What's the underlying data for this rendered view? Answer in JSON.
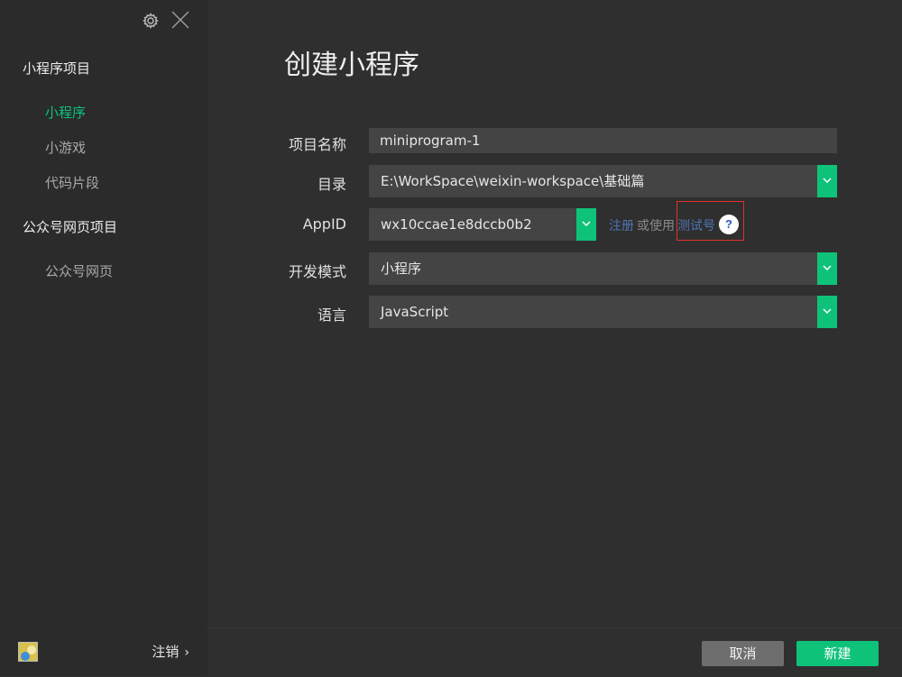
{
  "sidebar": {
    "sections": [
      {
        "title": "小程序项目",
        "items": [
          {
            "label": "小程序",
            "active": true
          },
          {
            "label": "小游戏",
            "active": false
          },
          {
            "label": "代码片段",
            "active": false
          }
        ]
      },
      {
        "title": "公众号网页项目",
        "items": [
          {
            "label": "公众号网页",
            "active": false
          }
        ]
      }
    ],
    "footer": {
      "logout_label": "注销",
      "chevron": "›",
      "avatar_icon": "avatar-image"
    },
    "top_icons": [
      "gear-icon",
      "close-icon"
    ]
  },
  "main": {
    "title": "创建小程序",
    "form": {
      "project_name": {
        "label": "项目名称",
        "value": "miniprogram-1"
      },
      "directory": {
        "label": "目录",
        "value": "E:\\WorkSpace\\weixin-workspace\\基础篇"
      },
      "appid": {
        "label": "AppID",
        "value": "wx10ccae1e8dccb0b2",
        "register_link": "注册",
        "or_use": "或使用",
        "test_link": "测试号",
        "help": "?"
      },
      "dev_mode": {
        "label": "开发模式",
        "value": "小程序"
      },
      "language": {
        "label": "语言",
        "value": "JavaScript"
      }
    },
    "buttons": {
      "cancel": "取消",
      "create": "新建"
    }
  },
  "colors": {
    "accent": "#0fc27a",
    "link": "#4f74b3",
    "highlight_box": "#e0322b",
    "background": "#2f2f2f",
    "sidebar": "#2b2b2b"
  }
}
